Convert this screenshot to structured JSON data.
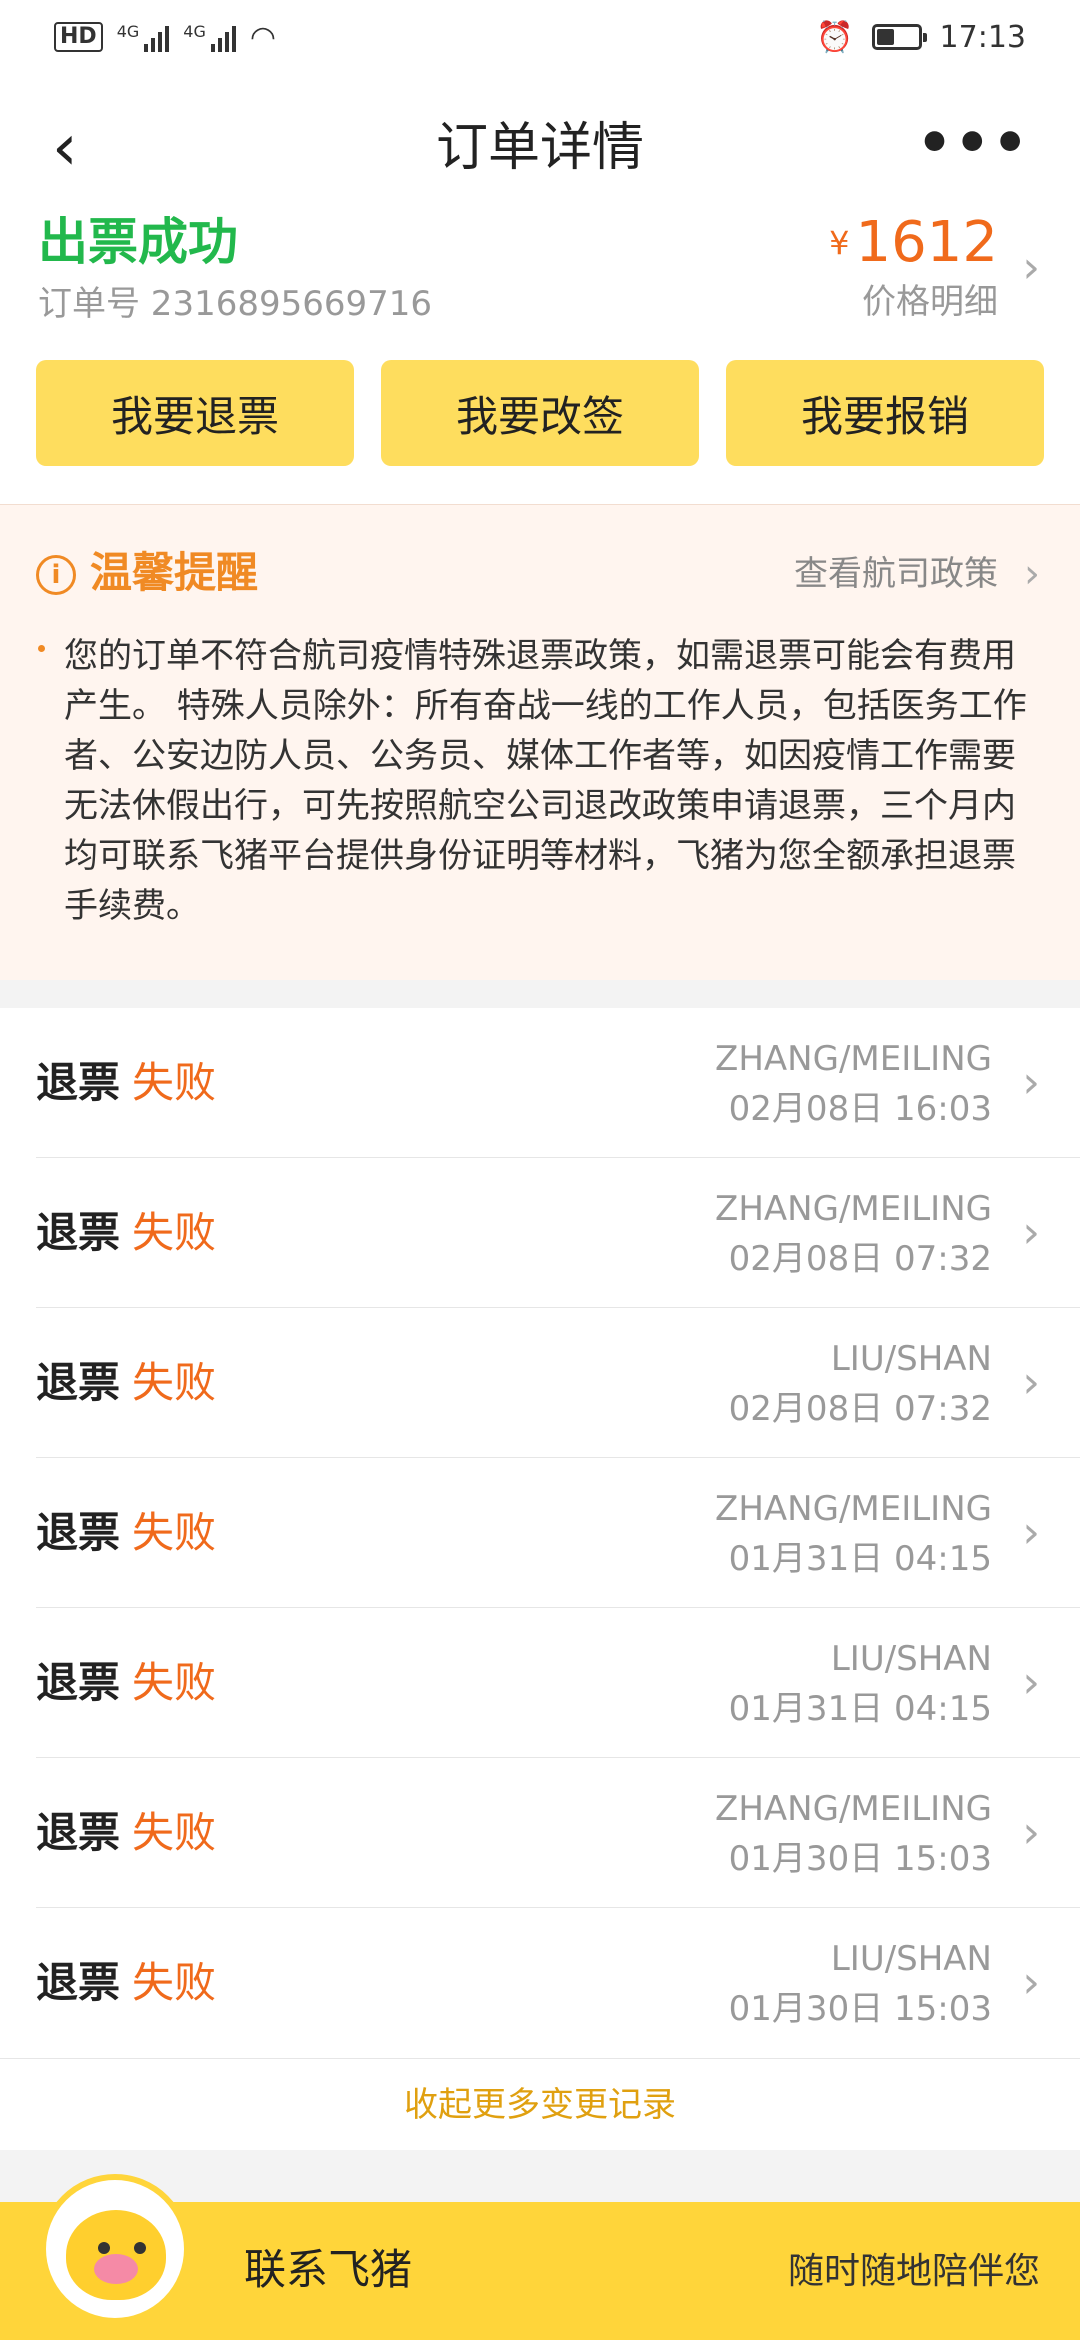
{
  "status_bar": {
    "hd": "HD",
    "network1": "4G",
    "network2": "4G",
    "time": "17:13"
  },
  "nav": {
    "back": "‹",
    "title": "订单详情",
    "more": "•••"
  },
  "order": {
    "status": "出票成功",
    "order_no": "订单号 2316895669716",
    "currency": "¥",
    "price": "1612",
    "price_detail": "价格明细"
  },
  "actions": {
    "refund": "我要退票",
    "change": "我要改签",
    "reimburse": "我要报销"
  },
  "notice": {
    "icon": "i",
    "title": "温馨提醒",
    "policy_link": "查看航司政策",
    "body": "您的订单不符合航司疫情特殊退票政策，如需退票可能会有费用产生。 特殊人员除外：所有奋战一线的工作人员，包括医务工作者、公安边防人员、公务员、媒体工作者等，如因疫情工作需要无法休假出行，可先按照航空公司退改政策申请退票，三个月内均可联系飞猪平台提供身份证明等材料，飞猪为您全额承担退票手续费。"
  },
  "records": [
    {
      "label": "退票",
      "status": "失败",
      "name": "ZHANG/MEILING",
      "time": "02月08日 16:03"
    },
    {
      "label": "退票",
      "status": "失败",
      "name": "ZHANG/MEILING",
      "time": "02月08日 07:32"
    },
    {
      "label": "退票",
      "status": "失败",
      "name": "LIU/SHAN",
      "time": "02月08日 07:32"
    },
    {
      "label": "退票",
      "status": "失败",
      "name": "ZHANG/MEILING",
      "time": "01月31日 04:15"
    },
    {
      "label": "退票",
      "status": "失败",
      "name": "LIU/SHAN",
      "time": "01月31日 04:15"
    },
    {
      "label": "退票",
      "status": "失败",
      "name": "ZHANG/MEILING",
      "time": "01月30日 15:03"
    },
    {
      "label": "退票",
      "status": "失败",
      "name": "LIU/SHAN",
      "time": "01月30日 15:03"
    }
  ],
  "collapse_label": "收起更多变更记录",
  "contact": {
    "title": "联系飞猪",
    "subtitle": "随时随地陪伴您"
  },
  "colors": {
    "success": "#22b84c",
    "price": "#f06a1b",
    "button": "#fedd5e",
    "notice_bg": "#fff5ef",
    "notice_accent": "#f08a24",
    "collapse": "#e0a010",
    "contact_bar": "#ffd53a"
  }
}
